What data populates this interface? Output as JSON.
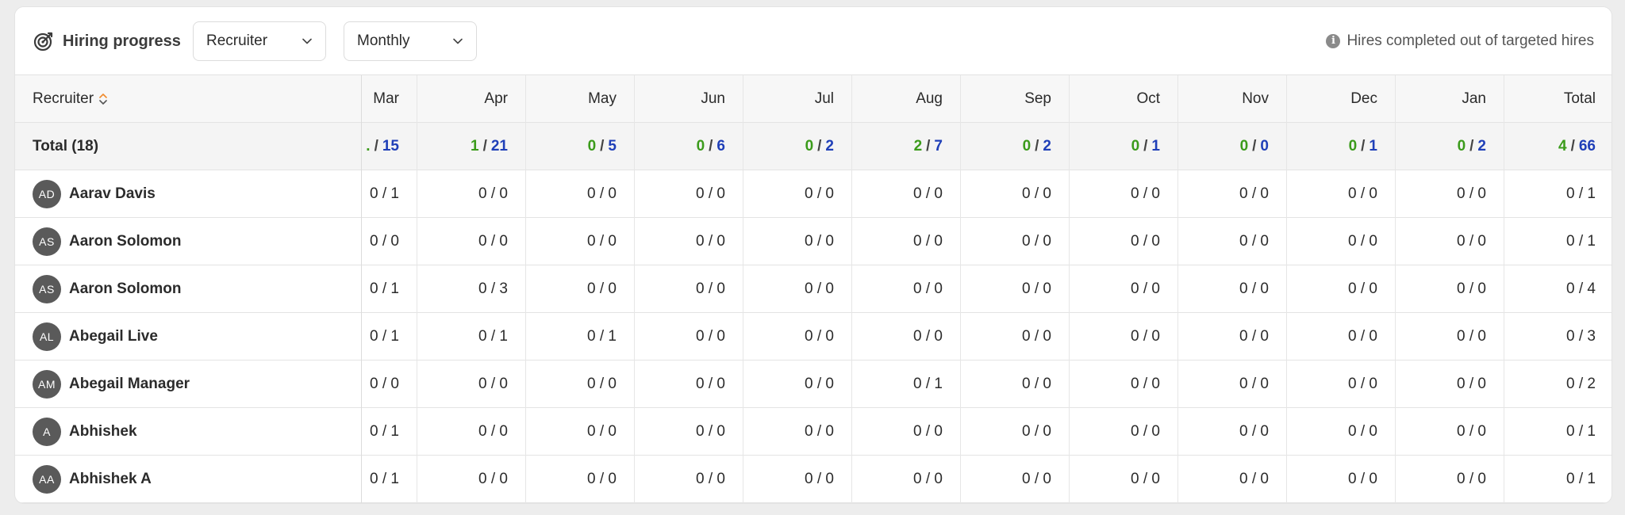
{
  "toolbar": {
    "title": "Hiring progress",
    "group_by": "Recruiter",
    "period": "Monthly",
    "info_text": "Hires completed out of targeted hires"
  },
  "table": {
    "first_header": "Recruiter",
    "months": [
      "Mar",
      "Apr",
      "May",
      "Jun",
      "Jul",
      "Aug",
      "Sep",
      "Oct",
      "Nov",
      "Dec",
      "Jan",
      "Total"
    ],
    "total_label": "Total (18)",
    "totals": [
      {
        "h": ".",
        "t": "15"
      },
      {
        "h": "1",
        "t": "21"
      },
      {
        "h": "0",
        "t": "5"
      },
      {
        "h": "0",
        "t": "6"
      },
      {
        "h": "0",
        "t": "2"
      },
      {
        "h": "2",
        "t": "7"
      },
      {
        "h": "0",
        "t": "2"
      },
      {
        "h": "0",
        "t": "1"
      },
      {
        "h": "0",
        "t": "0"
      },
      {
        "h": "0",
        "t": "1"
      },
      {
        "h": "0",
        "t": "2"
      },
      {
        "h": "4",
        "t": "66"
      }
    ],
    "rows": [
      {
        "initials": "AD",
        "name": "Aarav Davis",
        "values": [
          "0 / 1",
          "0 / 0",
          "0 / 0",
          "0 / 0",
          "0 / 0",
          "0 / 0",
          "0 / 0",
          "0 / 0",
          "0 / 0",
          "0 / 0",
          "0 / 0",
          "0 / 1"
        ]
      },
      {
        "initials": "AS",
        "name": "Aaron Solomon",
        "values": [
          "0 / 0",
          "0 / 0",
          "0 / 0",
          "0 / 0",
          "0 / 0",
          "0 / 0",
          "0 / 0",
          "0 / 0",
          "0 / 0",
          "0 / 0",
          "0 / 0",
          "0 / 1"
        ]
      },
      {
        "initials": "AS",
        "name": "Aaron Solomon",
        "values": [
          "0 / 1",
          "0 / 3",
          "0 / 0",
          "0 / 0",
          "0 / 0",
          "0 / 0",
          "0 / 0",
          "0 / 0",
          "0 / 0",
          "0 / 0",
          "0 / 0",
          "0 / 4"
        ]
      },
      {
        "initials": "AL",
        "name": "Abegail Live",
        "values": [
          "0 / 1",
          "0 / 1",
          "0 / 1",
          "0 / 0",
          "0 / 0",
          "0 / 0",
          "0 / 0",
          "0 / 0",
          "0 / 0",
          "0 / 0",
          "0 / 0",
          "0 / 3"
        ]
      },
      {
        "initials": "AM",
        "name": "Abegail Manager",
        "values": [
          "0 / 0",
          "0 / 0",
          "0 / 0",
          "0 / 0",
          "0 / 0",
          "0 / 1",
          "0 / 0",
          "0 / 0",
          "0 / 0",
          "0 / 0",
          "0 / 0",
          "0 / 2"
        ]
      },
      {
        "initials": "A",
        "name": "Abhishek",
        "values": [
          "0 / 1",
          "0 / 0",
          "0 / 0",
          "0 / 0",
          "0 / 0",
          "0 / 0",
          "0 / 0",
          "0 / 0",
          "0 / 0",
          "0 / 0",
          "0 / 0",
          "0 / 1"
        ]
      },
      {
        "initials": "AA",
        "name": "Abhishek A",
        "values": [
          "0 / 1",
          "0 / 0",
          "0 / 0",
          "0 / 0",
          "0 / 0",
          "0 / 0",
          "0 / 0",
          "0 / 0",
          "0 / 0",
          "0 / 0",
          "0 / 0",
          "0 / 1"
        ]
      }
    ]
  },
  "colors": {
    "hires": "#3b9b1b",
    "targets": "#1f3fb8",
    "sort_active": "#f08a2c"
  }
}
